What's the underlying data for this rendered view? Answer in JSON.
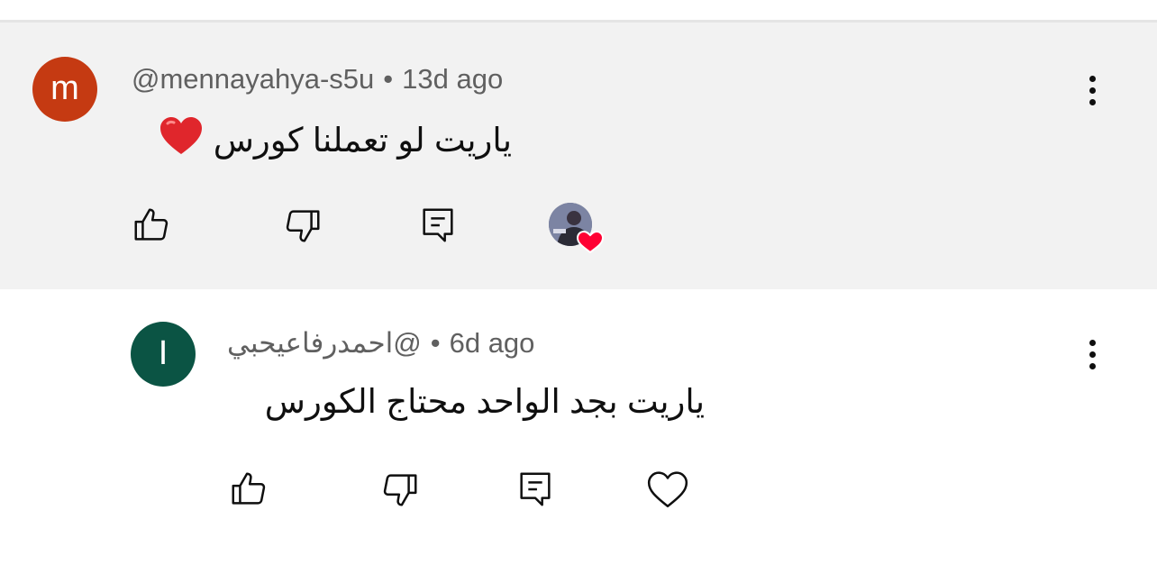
{
  "comments": [
    {
      "avatar_letter": "m",
      "avatar_color": "#c53a12",
      "handle": "@mennayahya-s5u",
      "separator": "•",
      "time": "13d ago",
      "text": "ياريت لو تعملنا كورس",
      "has_heart_emoji": true,
      "highlighted": true,
      "actions": [
        "like-icon",
        "dislike-icon",
        "reply-icon",
        "creator-heart-icon"
      ]
    },
    {
      "avatar_letter": "I",
      "avatar_color": "#0b5444",
      "handle": "@احمدرفاعيحبي",
      "separator": "•",
      "time": "6d ago",
      "text": "ياريت بجد الواحد محتاج الكورس",
      "has_heart_emoji": false,
      "highlighted": false,
      "actions": [
        "like-icon",
        "dislike-icon",
        "reply-icon",
        "heart-outline-icon"
      ]
    }
  ],
  "colors": {
    "highlight_bg": "#f2f2f2",
    "meta_text": "#606060",
    "heart_red": "#ff0033"
  }
}
